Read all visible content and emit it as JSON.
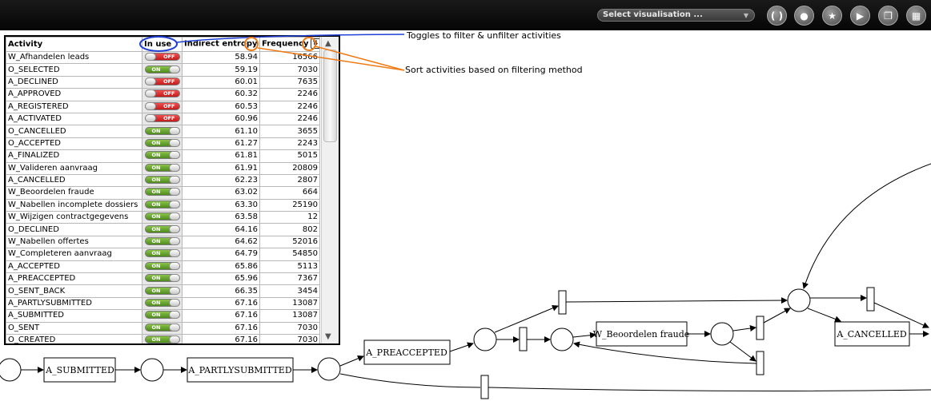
{
  "toolbar": {
    "select_visualisation": "Select visualisation ...",
    "buttons": [
      {
        "icon": "parentheses-icon",
        "glyph": "( )"
      },
      {
        "icon": "drop-icon",
        "glyph": "●"
      },
      {
        "icon": "star-icon",
        "glyph": "★"
      },
      {
        "icon": "play-icon",
        "glyph": "▶"
      },
      {
        "icon": "copy-icon",
        "glyph": "❐"
      },
      {
        "icon": "grid-icon",
        "glyph": "▦"
      }
    ]
  },
  "table": {
    "headers": {
      "activity": "Activity",
      "in_use": "In use",
      "entropy": "Indirect entropy",
      "frequency": "Frequency"
    },
    "toggle_on": "ON",
    "toggle_off": "OFF",
    "rows": [
      {
        "activity": "W_Afhandelen leads",
        "in_use": false,
        "entropy": "58.94",
        "frequency": "16566"
      },
      {
        "activity": "O_SELECTED",
        "in_use": true,
        "entropy": "59.19",
        "frequency": "7030"
      },
      {
        "activity": "A_DECLINED",
        "in_use": false,
        "entropy": "60.01",
        "frequency": "7635"
      },
      {
        "activity": "A_APPROVED",
        "in_use": false,
        "entropy": "60.32",
        "frequency": "2246"
      },
      {
        "activity": "A_REGISTERED",
        "in_use": false,
        "entropy": "60.53",
        "frequency": "2246"
      },
      {
        "activity": "A_ACTIVATED",
        "in_use": false,
        "entropy": "60.96",
        "frequency": "2246"
      },
      {
        "activity": "O_CANCELLED",
        "in_use": true,
        "entropy": "61.10",
        "frequency": "3655"
      },
      {
        "activity": "O_ACCEPTED",
        "in_use": true,
        "entropy": "61.27",
        "frequency": "2243"
      },
      {
        "activity": "A_FINALIZED",
        "in_use": true,
        "entropy": "61.81",
        "frequency": "5015"
      },
      {
        "activity": "W_Valideren aanvraag",
        "in_use": true,
        "entropy": "61.91",
        "frequency": "20809"
      },
      {
        "activity": "A_CANCELLED",
        "in_use": true,
        "entropy": "62.23",
        "frequency": "2807"
      },
      {
        "activity": "W_Beoordelen fraude",
        "in_use": true,
        "entropy": "63.02",
        "frequency": "664"
      },
      {
        "activity": "W_Nabellen incomplete dossiers",
        "in_use": true,
        "entropy": "63.30",
        "frequency": "25190"
      },
      {
        "activity": "W_Wijzigen contractgegevens",
        "in_use": true,
        "entropy": "63.58",
        "frequency": "12"
      },
      {
        "activity": "O_DECLINED",
        "in_use": true,
        "entropy": "64.16",
        "frequency": "802"
      },
      {
        "activity": "W_Nabellen offertes",
        "in_use": true,
        "entropy": "64.62",
        "frequency": "52016"
      },
      {
        "activity": "W_Completeren aanvraag",
        "in_use": true,
        "entropy": "64.79",
        "frequency": "54850"
      },
      {
        "activity": "A_ACCEPTED",
        "in_use": true,
        "entropy": "65.86",
        "frequency": "5113"
      },
      {
        "activity": "A_PREACCEPTED",
        "in_use": true,
        "entropy": "65.96",
        "frequency": "7367"
      },
      {
        "activity": "O_SENT_BACK",
        "in_use": true,
        "entropy": "66.35",
        "frequency": "3454"
      },
      {
        "activity": "A_PARTLYSUBMITTED",
        "in_use": true,
        "entropy": "67.16",
        "frequency": "13087"
      },
      {
        "activity": "A_SUBMITTED",
        "in_use": true,
        "entropy": "67.16",
        "frequency": "13087"
      },
      {
        "activity": "O_SENT",
        "in_use": true,
        "entropy": "67.16",
        "frequency": "7030"
      },
      {
        "activity": "O_CREATED",
        "in_use": true,
        "entropy": "67.16",
        "frequency": "7030"
      }
    ]
  },
  "annotations": {
    "toggles": "Toggles to filter & unfilter activities",
    "sort": "Sort activities based on filtering method"
  },
  "petri": {
    "transitions": {
      "a_submitted": "A_SUBMITTED",
      "a_partlysubmitted": "A_PARTLYSUBMITTED",
      "a_preaccepted": "A_PREACCEPTED",
      "w_beoordelen_fraude": "W_Beoordelen fraude",
      "a_cancelled": "A_CANCELLED"
    }
  },
  "colors": {
    "toggle_on": "#5c9e2a",
    "toggle_off": "#d42a2a",
    "annotation_blue": "#1f3fd6",
    "annotation_orange": "#f07a14"
  }
}
